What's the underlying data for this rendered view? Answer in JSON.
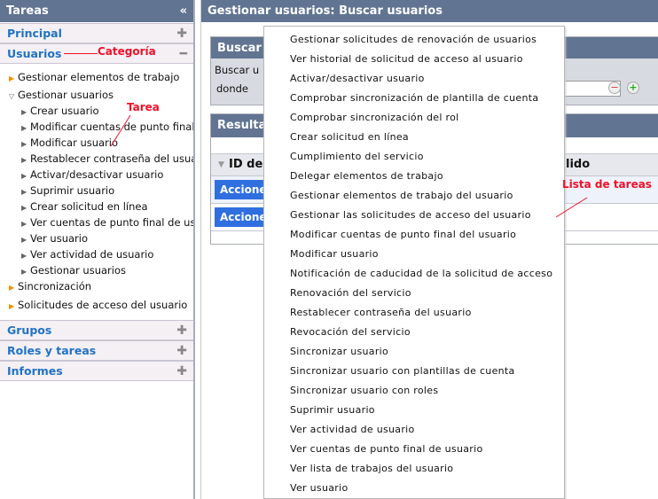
{
  "sidebar": {
    "title": "Tareas",
    "collapse_icon": "double-chevron-left-icon",
    "categories": {
      "principal": "Principal",
      "usuarios": "Usuarios",
      "grupos": "Grupos",
      "roles": "Roles y tareas",
      "informes": "Informes"
    },
    "tree": [
      {
        "label": "Gestionar elementos de trabajo",
        "level": 0,
        "icon": "orange-arrow"
      },
      {
        "label": "Gestionar usuarios",
        "level": 0,
        "icon": "expanded-triangle"
      },
      {
        "label": "Crear usuario",
        "level": 1
      },
      {
        "label": "Modificar cuentas de punto final de usuario",
        "level": 1
      },
      {
        "label": "Modificar usuario",
        "level": 1
      },
      {
        "label": "Restablecer contraseña del usuario",
        "level": 1
      },
      {
        "label": "Activar/desactivar usuario",
        "level": 1
      },
      {
        "label": "Suprimir usuario",
        "level": 1
      },
      {
        "label": "Crear solicitud en línea",
        "level": 1
      },
      {
        "label": "Ver cuentas de punto final de usuario",
        "level": 1
      },
      {
        "label": "Ver usuario",
        "level": 1
      },
      {
        "label": "Ver actividad de usuario",
        "level": 1
      },
      {
        "label": "Gestionar usuarios",
        "level": 1
      },
      {
        "label": "Sincronización",
        "level": 0,
        "icon": "orange-arrow"
      },
      {
        "label": "Solicitudes de acceso del usuario",
        "level": 0,
        "icon": "orange-arrow"
      }
    ]
  },
  "main": {
    "title": "Gestionar usuarios: Buscar usuarios",
    "search": {
      "title": "Buscar u",
      "line1": "Buscar u",
      "line2": "donde"
    },
    "results": {
      "title": "Resultad",
      "col_id": "ID de",
      "col_last": "lido",
      "actions": [
        "Accione",
        "Accione"
      ]
    }
  },
  "menu": {
    "items": [
      "Gestionar solicitudes de renovación de usuarios",
      "Ver historial de solicitud de acceso al usuario",
      "Activar/desactivar usuario",
      "Comprobar sincronización de plantilla de cuenta",
      "Comprobar sincronización del rol",
      "Crear solicitud en línea",
      "Cumplimiento del servicio",
      "Delegar elementos de trabajo",
      "Gestionar elementos de trabajo del usuario",
      "Gestionar las solicitudes de acceso del usuario",
      "Modificar cuentas de punto final del usuario",
      "Modificar usuario",
      "Notificación de caducidad de la solicitud de acceso",
      "Renovación del servicio",
      "Restablecer contraseña del usuario",
      "Revocación del servicio",
      "Sincronizar usuario",
      "Sincronizar usuario con plantillas de cuenta",
      "Sincronizar usuario con roles",
      "Suprimir usuario",
      "Ver actividad de usuario",
      "Ver cuentas de punto final de usuario",
      "Ver lista de trabajos del usuario",
      "Ver usuario"
    ]
  },
  "annotations": {
    "categoria": "Categoría",
    "tarea": "Tarea",
    "lista": "Lista de tareas"
  },
  "colors": {
    "header": "#617491",
    "category_text": "#2272c3",
    "annotation": "#f0102a",
    "action_button": "#2f6fe0"
  }
}
